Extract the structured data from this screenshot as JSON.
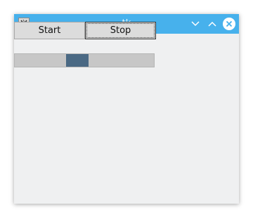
{
  "window": {
    "title": "tk",
    "titlebar_color": "#47b1ec",
    "icons": {
      "app": "tk-app-icon",
      "minimize": "chevron-down-icon",
      "maximize": "chevron-up-icon",
      "close": "close-circle-icon"
    }
  },
  "controls": {
    "start_label": "Start",
    "stop_label": "Stop"
  },
  "progress": {
    "mode": "indeterminate",
    "indicator_position_fraction": 0.37,
    "indicator_width_fraction": 0.16,
    "indicator_color": "#4a6984"
  }
}
